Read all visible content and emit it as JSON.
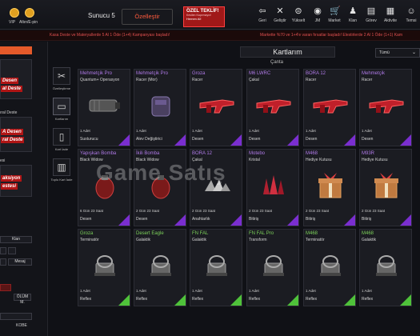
{
  "topbar": {
    "vip_label": "VIP",
    "altin_label": "Altın/E-pin",
    "server": "Sunucu 5",
    "customize_button": "Özelleştir",
    "offer": {
      "title": "ÖZEL TEKLİF!",
      "subtitle": "Kesilen Kaçırmayın!",
      "button": "Hemen Al!"
    },
    "nav": [
      {
        "label": "Geri",
        "icon": "back-icon"
      },
      {
        "label": "Geliştir",
        "icon": "tools-icon"
      },
      {
        "label": "Yükselt",
        "icon": "upgrade-icon"
      },
      {
        "label": "JM",
        "icon": "jm-icon"
      },
      {
        "label": "Market",
        "icon": "cart-icon"
      },
      {
        "label": "Klan",
        "icon": "clan-icon"
      },
      {
        "label": "Görev",
        "icon": "mission-icon"
      },
      {
        "label": "Aktivite",
        "icon": "activity-icon"
      },
      {
        "label": "Temsi",
        "icon": "user-icon"
      }
    ]
  },
  "ticker": {
    "left": "Kasa Deste ve Materyallerde 5 Al 1 Öde (1+4) Kampanyası başladı!",
    "right": "Markette %70 ve 1+4'e varan fırsatlar başladı!   Elestirlerde 2 Al 1 Öde (1+1) Kam"
  },
  "left_panel": {
    "promo1_line1": "Desen",
    "promo1_line2": "al Deste",
    "label_deste": "ıral Deste",
    "promo2_line1": "A Desen",
    "promo2_line2": "ral Deste",
    "label_esi": "esi",
    "promo3_line1": "aksiyon",
    "promo3_line2": "estesi",
    "klan_button": "Klan",
    "mesaj_button": "Mesaj",
    "status_label": "ÖLÜM M.",
    "kobe_label": "KOBE"
  },
  "filters": [
    {
      "label": "Özelleştirme",
      "icon": "customize-icon"
    },
    {
      "label": "Kartlarım",
      "icon": "cards-icon"
    },
    {
      "label": "Kart İade",
      "icon": "card-return-icon"
    },
    {
      "label": "Toplu Kart İade",
      "icon": "bulk-return-icon"
    }
  ],
  "main": {
    "title": "Kartlarım",
    "subtitle": "Çanta",
    "dropdown_value": "Tümü"
  },
  "watermark": "Game Satış",
  "cards": [
    {
      "name": "Mehmetçik Pro",
      "sub": "Quantum+ Operasyon",
      "qty": "1 Adet",
      "type": "Susturucu",
      "rarity": "purple",
      "art": "silencer-icon"
    },
    {
      "name": "Mehmetçik Pro",
      "sub": "Racer (Mor)",
      "qty": "1 Adet",
      "type": "Alev Değiştirici",
      "rarity": "purple",
      "art": "flash-hider-icon"
    },
    {
      "name": "Groza",
      "sub": "Racer",
      "qty": "1 Adet",
      "type": "Desen",
      "rarity": "purple",
      "art": "rifle-skin-icon"
    },
    {
      "name": "M6 LWRC",
      "sub": "Çakal",
      "qty": "1 Adet",
      "type": "Desen",
      "rarity": "purple",
      "art": "rifle-skin-icon"
    },
    {
      "name": "BORA 12",
      "sub": "Racer",
      "qty": "1 Adet",
      "type": "Desen",
      "rarity": "purple",
      "art": "rifle-skin-icon"
    },
    {
      "name": "Mehmetçik",
      "sub": "Racer",
      "qty": "1 Adet",
      "type": "Desen",
      "rarity": "purple",
      "art": "rifle-skin-icon"
    },
    {
      "name": "Yapışkan Bomba",
      "sub": "Black Widow",
      "qty": "6 Gün 23 Saat",
      "type": "Desen",
      "rarity": "purple",
      "art": "grenade-icon"
    },
    {
      "name": "İkili Bomba",
      "sub": "Black Widow",
      "qty": "2 Gün 23 Saat",
      "type": "Desen",
      "rarity": "purple",
      "art": "grenade-icon"
    },
    {
      "name": "BORA 12",
      "sub": "Çakal",
      "qty": "2 Gün 23 Saat",
      "type": "Anahtarlık",
      "rarity": "purple",
      "art": "keychain-icon"
    },
    {
      "name": "Motebo",
      "sub": "Kristal",
      "qty": "2 Gün 23 Saat",
      "type": "Bitiriş",
      "rarity": "purple",
      "art": "crystal-icon"
    },
    {
      "name": "M468",
      "sub": "Hediye Kutusu",
      "qty": "2 Gün 23 Saat",
      "type": "Bitiriş",
      "rarity": "purple",
      "art": "gift-box-icon"
    },
    {
      "name": "M93R",
      "sub": "Hediye Kutusu",
      "qty": "2 Gün 23 Saat",
      "type": "Bitiriş",
      "rarity": "purple",
      "art": "gift-box-icon"
    },
    {
      "name": "Groza",
      "sub": "Terminatör",
      "qty": "1 Adet",
      "type": "Reflex",
      "rarity": "green",
      "art": "reflex-sight-icon"
    },
    {
      "name": "Desert Eagle",
      "sub": "Galaktik",
      "qty": "1 Adet",
      "type": "Reflex",
      "rarity": "green",
      "art": "reflex-sight-icon"
    },
    {
      "name": "FN FAL",
      "sub": "Galaktik",
      "qty": "1 Adet",
      "type": "Reflex",
      "rarity": "green",
      "art": "reflex-sight-icon"
    },
    {
      "name": "FN FAL Pro",
      "sub": "Transform",
      "qty": "1 Adet",
      "type": "Reflex",
      "rarity": "green",
      "art": "reflex-sight-icon"
    },
    {
      "name": "M468",
      "sub": "Terminatör",
      "qty": "1 Adet",
      "type": "Reflex",
      "rarity": "green",
      "art": "reflex-sight-icon"
    },
    {
      "name": "M468",
      "sub": "Galaktik",
      "qty": "1 Adet",
      "type": "Reflex",
      "rarity": "green",
      "art": "reflex-sight-icon"
    }
  ],
  "colors": {
    "purple_name": "#b07ae8",
    "green_name": "#7cd05a",
    "accent_orange": "#ff5a3d",
    "ticker_red": "#e05050"
  }
}
